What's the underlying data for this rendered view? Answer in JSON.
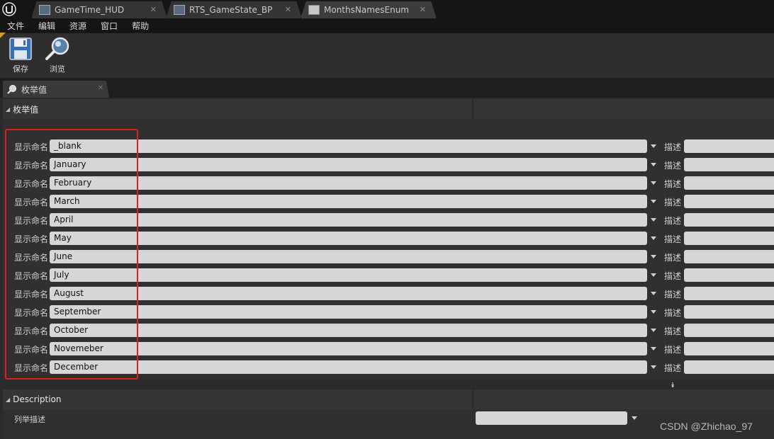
{
  "tabs": [
    {
      "label": "GameTime_HUD",
      "icon": "widget-blueprint-icon"
    },
    {
      "label": "RTS_GameState_BP",
      "icon": "blueprint-icon"
    },
    {
      "label": "MonthsNamesEnum",
      "icon": "enum-icon",
      "active": true
    }
  ],
  "menu": [
    "文件",
    "编辑",
    "资源",
    "窗口",
    "帮助"
  ],
  "toolbar": {
    "save_label": "保存",
    "browse_label": "浏览"
  },
  "panel_tab": {
    "label": "枚举值"
  },
  "enum_section": {
    "title": "枚举值",
    "display_name_label": "显示命名",
    "description_label": "描述",
    "entries": [
      "_blank",
      "January",
      "February",
      "March",
      "April",
      "May",
      "June",
      "July",
      "August",
      "September",
      "October",
      "Novemeber",
      "December"
    ]
  },
  "description_section": {
    "title": "Description",
    "field_label": "列举描述",
    "value": ""
  },
  "watermark": "CSDN @Zhichao_97",
  "colors": {
    "highlight": "#e02020",
    "accent": "#d19a2a"
  }
}
